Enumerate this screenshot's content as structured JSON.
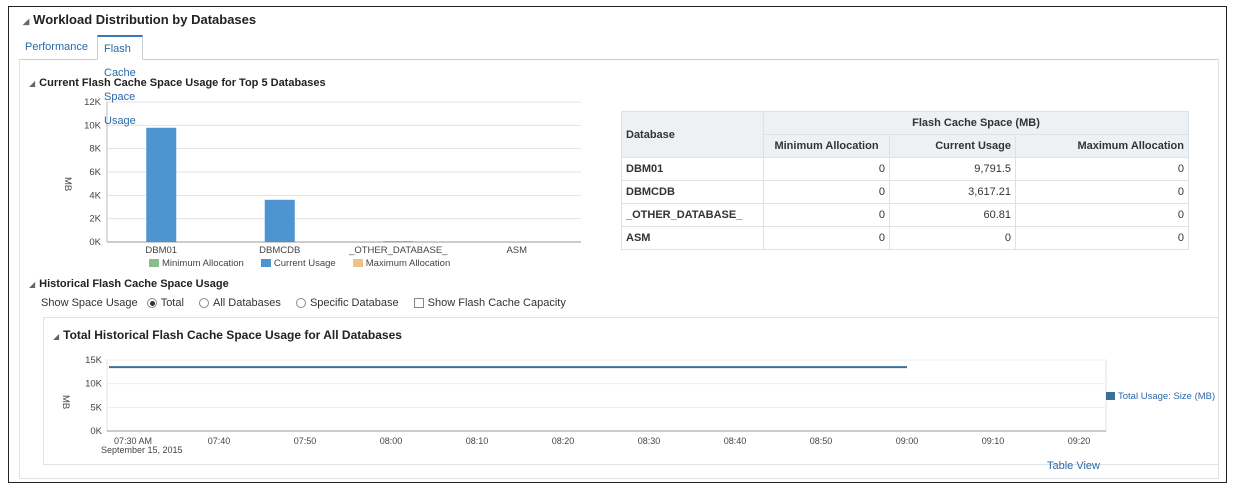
{
  "header": {
    "title": "Workload Distribution by Databases"
  },
  "tabs": [
    {
      "label": "Performance",
      "active": false
    },
    {
      "label": "Flash Cache Space Usage",
      "active": true
    }
  ],
  "current_section": {
    "title": "Current Flash Cache Space Usage for Top 5 Databases",
    "y_unit": "MB"
  },
  "chart_data": [
    {
      "type": "bar",
      "title": "Current Flash Cache Space Usage for Top 5 Databases",
      "ylabel": "MB",
      "ylim": [
        0,
        12000
      ],
      "yticks": [
        "0K",
        "2K",
        "4K",
        "6K",
        "8K",
        "10K",
        "12K"
      ],
      "categories": [
        "DBM01",
        "DBMCDB",
        "_OTHER_DATABASE_",
        "ASM"
      ],
      "series": [
        {
          "name": "Minimum Allocation",
          "color": "#8cbc8c",
          "values": [
            0,
            0,
            0,
            0
          ]
        },
        {
          "name": "Current Usage",
          "color": "#4e94d0",
          "values": [
            9791.5,
            3617.21,
            60.81,
            0
          ]
        },
        {
          "name": "Maximum Allocation",
          "color": "#f0c08a",
          "values": [
            0,
            0,
            0,
            0
          ]
        }
      ],
      "grid": true,
      "legend": "bottom"
    },
    {
      "type": "line",
      "title": "Total Historical Flash Cache Space Usage for All Databases",
      "ylabel": "MB",
      "ylim": [
        0,
        15000
      ],
      "yticks": [
        "0K",
        "5K",
        "10K",
        "15K"
      ],
      "xticks": [
        "07:30 AM",
        "07:40",
        "07:50",
        "08:00",
        "08:10",
        "08:20",
        "08:30",
        "08:40",
        "08:50",
        "09:00",
        "09:10",
        "09:20"
      ],
      "x_date_label": "September 15, 2015",
      "series": [
        {
          "name": "Total Usage: Size (MB)",
          "color": "#3a6f9a",
          "x": [
            "07:30 AM",
            "09:00"
          ],
          "values": [
            13500,
            13500
          ]
        }
      ],
      "legend": "right"
    }
  ],
  "space_table": {
    "col_database": "Database",
    "group_header": "Flash Cache Space (MB)",
    "col_min": "Minimum Allocation",
    "col_current": "Current Usage",
    "col_max": "Maximum Allocation",
    "rows": [
      {
        "name": "DBM01",
        "min": "0",
        "current": "9,791.5",
        "max": "0"
      },
      {
        "name": "DBMCDB",
        "min": "0",
        "current": "3,617.21",
        "max": "0"
      },
      {
        "name": "_OTHER_DATABASE_",
        "min": "0",
        "current": "60.81",
        "max": "0"
      },
      {
        "name": "ASM",
        "min": "0",
        "current": "0",
        "max": "0"
      }
    ]
  },
  "historical": {
    "title": "Historical Flash Cache Space Usage",
    "show_label": "Show Space Usage",
    "options": [
      {
        "label": "Total",
        "selected": true
      },
      {
        "label": "All Databases",
        "selected": false
      },
      {
        "label": "Specific Database",
        "selected": false
      }
    ],
    "capacity_label": "Show Flash Cache Capacity",
    "capacity_checked": false,
    "chart_title": "Total Historical Flash Cache Space Usage for All Databases",
    "y_unit": "MB"
  },
  "table_view_link": "Table View"
}
